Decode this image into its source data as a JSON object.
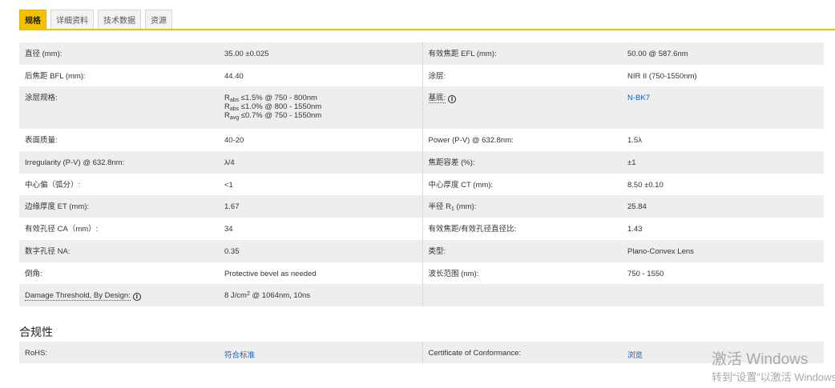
{
  "tabs": [
    {
      "label": "规格",
      "active": true
    },
    {
      "label": "详细资料",
      "active": false
    },
    {
      "label": "技术数据",
      "active": false
    },
    {
      "label": "资源",
      "active": false
    }
  ],
  "specs": {
    "r0": {
      "l1": "直径 (mm):",
      "v1": "35.00 ±0.025",
      "l2": "有效焦距 EFL (mm):",
      "v2": "50.00 @ 587.6nm"
    },
    "r1": {
      "l1": "后焦距 BFL (mm):",
      "v1": "44.40",
      "l2": "涂层:",
      "v2": "NIR II (750-1550nm)"
    },
    "r2": {
      "l1": "涂层规格:",
      "coat": [
        {
          "r": "R",
          "sub": "abs",
          "text": " ≤1.5% @ 750 - 800nm"
        },
        {
          "r": "R",
          "sub": "abs",
          "text": " ≤1.0% @ 800 - 1550nm"
        },
        {
          "r": "R",
          "sub": "avg",
          "text": " ≤0.7% @ 750 - 1550nm"
        }
      ],
      "l2": "基底:",
      "v2": "N-BK7"
    },
    "r3": {
      "l1": "表面质量:",
      "v1": "40-20",
      "l2": "Power (P-V) @ 632.8nm:",
      "v2": "1.5λ"
    },
    "r4": {
      "l1": "Irregularity (P-V) @ 632.8nm:",
      "v1": "λ/4",
      "l2": "焦距容差 (%):",
      "v2": "±1"
    },
    "r5": {
      "l1": "中心偏（弧分）:",
      "v1": "<1",
      "l2": "中心厚度 CT (mm):",
      "v2": "8.50 ±0.10"
    },
    "r6": {
      "l1": "边缘厚度 ET (mm):",
      "v1": "1.67",
      "l2_main": "半径 R",
      "l2_sub": "1",
      "l2_tail": " (mm):",
      "v2": "25.84"
    },
    "r7": {
      "l1": "有效孔径 CA（mm）:",
      "v1": "34",
      "l2": "有效焦距/有效孔径直径比:",
      "v2": "1.43"
    },
    "r8": {
      "l1": "数字孔径 NA:",
      "v1": "0.35",
      "l2": "类型:",
      "v2": "Plano-Convex Lens"
    },
    "r9": {
      "l1": "倒角:",
      "v1": "Protective bevel as needed",
      "l2": "波长范围 (nm):",
      "v2": "750 - 1550"
    },
    "r10": {
      "l1": "Damage Threshold, By Design:",
      "v1_main": "8 J/cm",
      "v1_sup": "2",
      "v1_tail": " @ 1064nm, 10ns"
    }
  },
  "info_icon_glyph": "i",
  "compliance": {
    "title": "合规性",
    "rohs_label": "RoHS:",
    "rohs_value": "符合标准",
    "coc_label": "Certificate of Conformance:",
    "coc_value": "浏览"
  },
  "watermark": {
    "line1": "激活 Windows",
    "line2": "转到“设置”以激活 Windows。"
  },
  "colors": {
    "accent": "#f2c200",
    "link": "#1f5fa8",
    "row_alt": "#eeeeee"
  }
}
